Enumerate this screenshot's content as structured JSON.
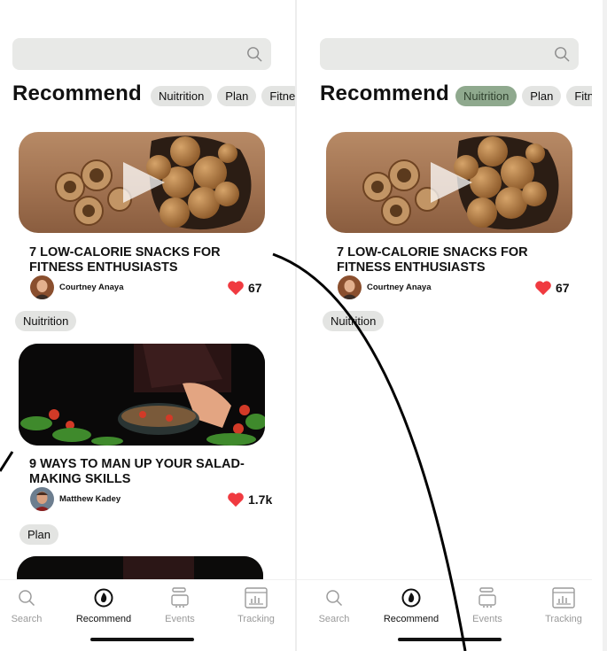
{
  "search": {
    "placeholder": ""
  },
  "section": {
    "title": "Recommend"
  },
  "chips": [
    "Nuitrition",
    "Plan",
    "Fitne"
  ],
  "cards": [
    {
      "title": "7 LOW-CALORIE SNACKS FOR FITNESS ENTHUSIASTS",
      "author": "Courtney Anaya",
      "likes": "67",
      "tag": "Nuitrition"
    },
    {
      "title": "9 WAYS TO MAN UP YOUR SALAD-MAKING SKILLS",
      "author": "Matthew Kadey",
      "likes": "1.7k",
      "tag": "Plan"
    }
  ],
  "tabs": [
    {
      "label": "Search",
      "icon": "search-icon"
    },
    {
      "label": "Recommend",
      "icon": "recommend-icon"
    },
    {
      "label": "Events",
      "icon": "events-icon"
    },
    {
      "label": "Tracking",
      "icon": "tracking-icon"
    }
  ],
  "screens": [
    {
      "active_chip": ""
    },
    {
      "active_chip": "Nuitrition"
    }
  ],
  "colors": {
    "accent_chip": "#8fa98e",
    "chip_bg": "#e3e4e2",
    "heart": "#f03a40",
    "search_bg": "#e8e9e7"
  }
}
